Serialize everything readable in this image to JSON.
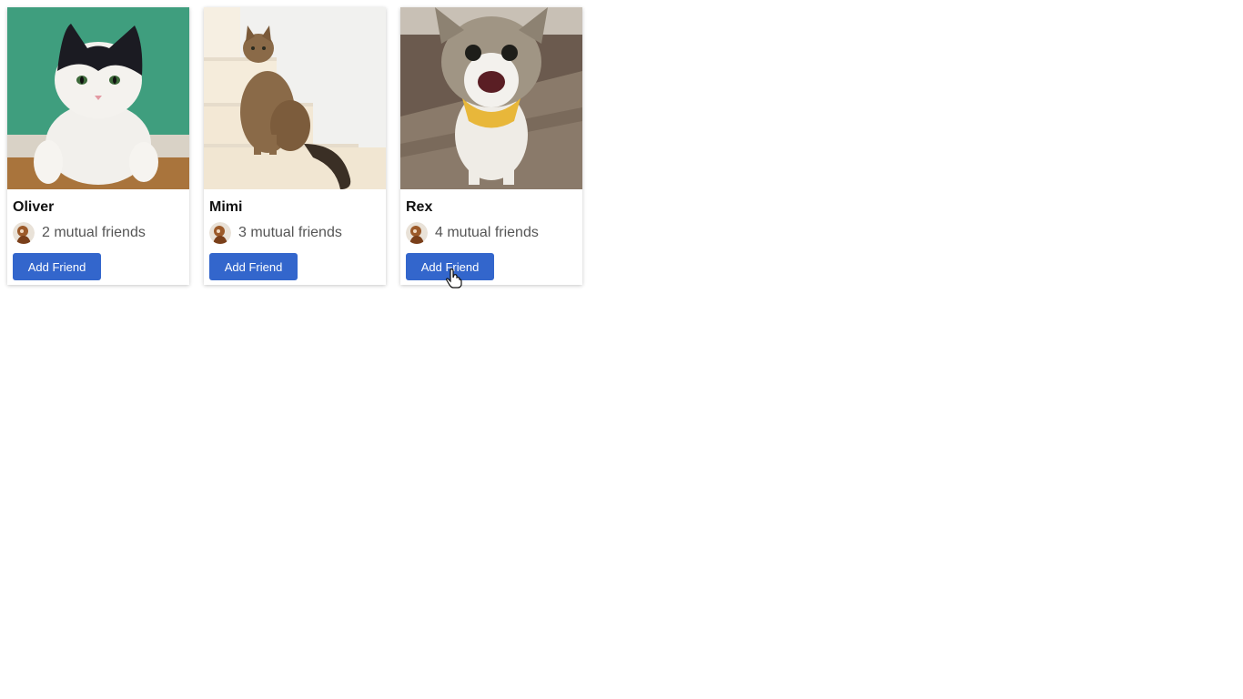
{
  "cards": [
    {
      "name": "Oliver",
      "mutual_friends": "2 mutual friends",
      "button_label": "Add Friend",
      "photo": "cat-photo-oliver"
    },
    {
      "name": "Mimi",
      "mutual_friends": "3 mutual friends",
      "button_label": "Add Friend",
      "photo": "cat-photo-mimi"
    },
    {
      "name": "Rex",
      "mutual_friends": "4 mutual friends",
      "button_label": "Add Friend",
      "photo": "cat-photo-rex"
    }
  ],
  "colors": {
    "button_bg": "#3366cc",
    "button_text": "#ffffff",
    "name_text": "#111111",
    "mutual_text": "#555555"
  },
  "icons": {
    "avatar": "mutual-friend-avatar-icon",
    "cursor": "hand-pointer-cursor-icon"
  }
}
